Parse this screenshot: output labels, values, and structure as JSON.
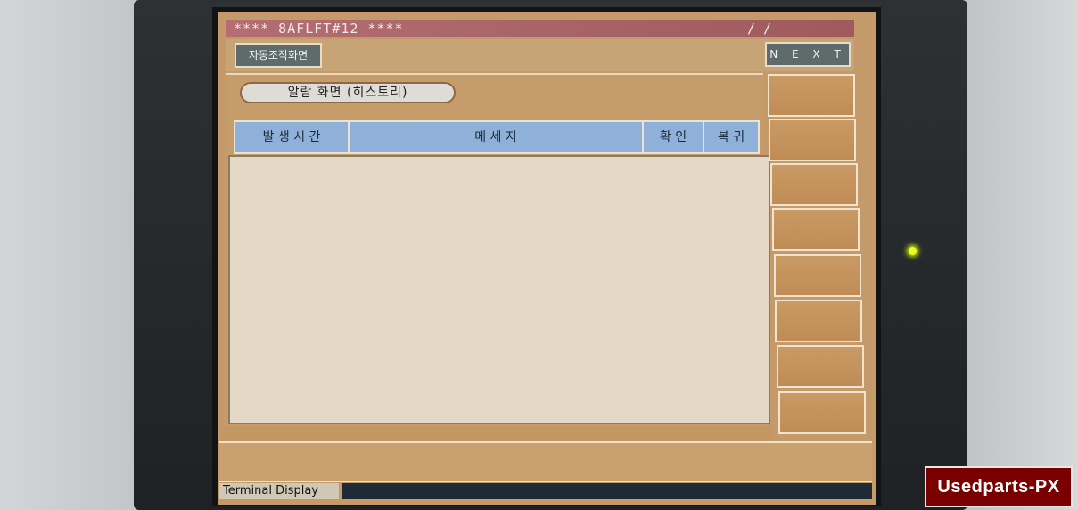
{
  "window": {
    "title": "**** 8AFLFT#12 ****",
    "date": "/  /"
  },
  "topbar": {
    "auto_button": "자동조작화면",
    "next_button": "N E X T"
  },
  "main": {
    "screen_title": "알람 화면 (히스토리)",
    "table": {
      "columns": [
        "발 생 시 간",
        "메     세     지",
        "확 인",
        "복 귀"
      ],
      "rows": []
    }
  },
  "side_panel": {
    "button_count": 8
  },
  "footer": {
    "label": "Terminal Display"
  },
  "watermark": "Usedparts-PX",
  "colors": {
    "titlebar": "#b46e72",
    "panel": "#c69c6b",
    "table_header": "#8fb0d8",
    "table_body": "#e6d8c6",
    "button_dark": "#5d6b6b",
    "led": "#e8ff2a"
  }
}
